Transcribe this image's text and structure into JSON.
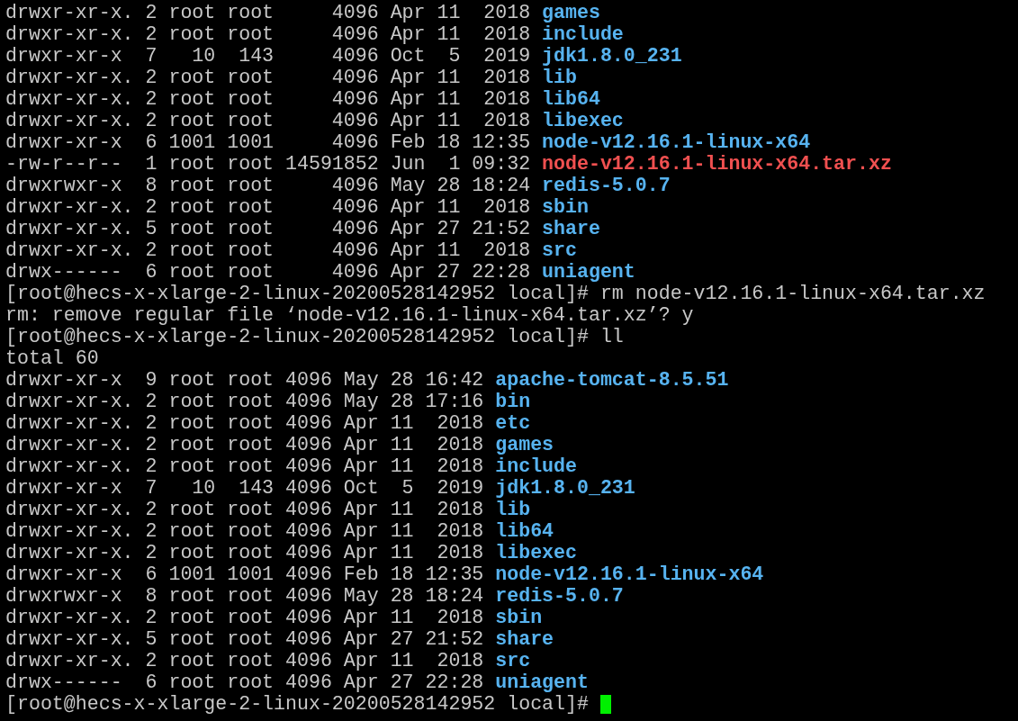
{
  "lines": [
    {
      "kind": "entry",
      "info": "drwxr-xr-x. 2 root root     4096 Apr 11  2018",
      "name": "games",
      "color": "#57b3f0"
    },
    {
      "kind": "entry",
      "info": "drwxr-xr-x. 2 root root     4096 Apr 11  2018",
      "name": "include",
      "color": "#57b3f0"
    },
    {
      "kind": "entry",
      "info": "drwxr-xr-x  7   10  143     4096 Oct  5  2019",
      "name": "jdk1.8.0_231",
      "color": "#57b3f0"
    },
    {
      "kind": "entry",
      "info": "drwxr-xr-x. 2 root root     4096 Apr 11  2018",
      "name": "lib",
      "color": "#57b3f0"
    },
    {
      "kind": "entry",
      "info": "drwxr-xr-x. 2 root root     4096 Apr 11  2018",
      "name": "lib64",
      "color": "#57b3f0"
    },
    {
      "kind": "entry",
      "info": "drwxr-xr-x. 2 root root     4096 Apr 11  2018",
      "name": "libexec",
      "color": "#57b3f0"
    },
    {
      "kind": "entry",
      "info": "drwxr-xr-x  6 1001 1001     4096 Feb 18 12:35",
      "name": "node-v12.16.1-linux-x64",
      "color": "#57b3f0"
    },
    {
      "kind": "entry",
      "info": "-rw-r--r--  1 root root 14591852 Jun  1 09:32",
      "name": "node-v12.16.1-linux-x64.tar.xz",
      "color": "#f05050"
    },
    {
      "kind": "entry",
      "info": "drwxrwxr-x  8 root root     4096 May 28 18:24",
      "name": "redis-5.0.7",
      "color": "#57b3f0"
    },
    {
      "kind": "entry",
      "info": "drwxr-xr-x. 2 root root     4096 Apr 11  2018",
      "name": "sbin",
      "color": "#57b3f0"
    },
    {
      "kind": "entry",
      "info": "drwxr-xr-x. 5 root root     4096 Apr 27 21:52",
      "name": "share",
      "color": "#57b3f0"
    },
    {
      "kind": "entry",
      "info": "drwxr-xr-x. 2 root root     4096 Apr 11  2018",
      "name": "src",
      "color": "#57b3f0"
    },
    {
      "kind": "entry",
      "info": "drwx------  6 root root     4096 Apr 27 22:28",
      "name": "uniagent",
      "color": "#57b3f0"
    },
    {
      "kind": "prompt",
      "text": "[root@hecs-x-xlarge-2-linux-20200528142952 local]# rm node-v12.16.1-linux-x64.tar.xz"
    },
    {
      "kind": "text",
      "text": "rm: remove regular file ‘node-v12.16.1-linux-x64.tar.xz’? y"
    },
    {
      "kind": "prompt",
      "text": "[root@hecs-x-xlarge-2-linux-20200528142952 local]# ll"
    },
    {
      "kind": "text",
      "text": "total 60"
    },
    {
      "kind": "entry",
      "info": "drwxr-xr-x  9 root root 4096 May 28 16:42",
      "name": "apache-tomcat-8.5.51",
      "color": "#57b3f0"
    },
    {
      "kind": "entry",
      "info": "drwxr-xr-x. 2 root root 4096 May 28 17:16",
      "name": "bin",
      "color": "#57b3f0"
    },
    {
      "kind": "entry",
      "info": "drwxr-xr-x. 2 root root 4096 Apr 11  2018",
      "name": "etc",
      "color": "#57b3f0"
    },
    {
      "kind": "entry",
      "info": "drwxr-xr-x. 2 root root 4096 Apr 11  2018",
      "name": "games",
      "color": "#57b3f0"
    },
    {
      "kind": "entry",
      "info": "drwxr-xr-x. 2 root root 4096 Apr 11  2018",
      "name": "include",
      "color": "#57b3f0"
    },
    {
      "kind": "entry",
      "info": "drwxr-xr-x  7   10  143 4096 Oct  5  2019",
      "name": "jdk1.8.0_231",
      "color": "#57b3f0"
    },
    {
      "kind": "entry",
      "info": "drwxr-xr-x. 2 root root 4096 Apr 11  2018",
      "name": "lib",
      "color": "#57b3f0"
    },
    {
      "kind": "entry",
      "info": "drwxr-xr-x. 2 root root 4096 Apr 11  2018",
      "name": "lib64",
      "color": "#57b3f0"
    },
    {
      "kind": "entry",
      "info": "drwxr-xr-x. 2 root root 4096 Apr 11  2018",
      "name": "libexec",
      "color": "#57b3f0"
    },
    {
      "kind": "entry",
      "info": "drwxr-xr-x  6 1001 1001 4096 Feb 18 12:35",
      "name": "node-v12.16.1-linux-x64",
      "color": "#57b3f0"
    },
    {
      "kind": "entry",
      "info": "drwxrwxr-x  8 root root 4096 May 28 18:24",
      "name": "redis-5.0.7",
      "color": "#57b3f0"
    },
    {
      "kind": "entry",
      "info": "drwxr-xr-x. 2 root root 4096 Apr 11  2018",
      "name": "sbin",
      "color": "#57b3f0"
    },
    {
      "kind": "entry",
      "info": "drwxr-xr-x. 5 root root 4096 Apr 27 21:52",
      "name": "share",
      "color": "#57b3f0"
    },
    {
      "kind": "entry",
      "info": "drwxr-xr-x. 2 root root 4096 Apr 11  2018",
      "name": "src",
      "color": "#57b3f0"
    },
    {
      "kind": "entry",
      "info": "drwx------  6 root root 4096 Apr 27 22:28",
      "name": "uniagent",
      "color": "#57b3f0"
    },
    {
      "kind": "input",
      "text": "[root@hecs-x-xlarge-2-linux-20200528142952 local]#"
    }
  ]
}
